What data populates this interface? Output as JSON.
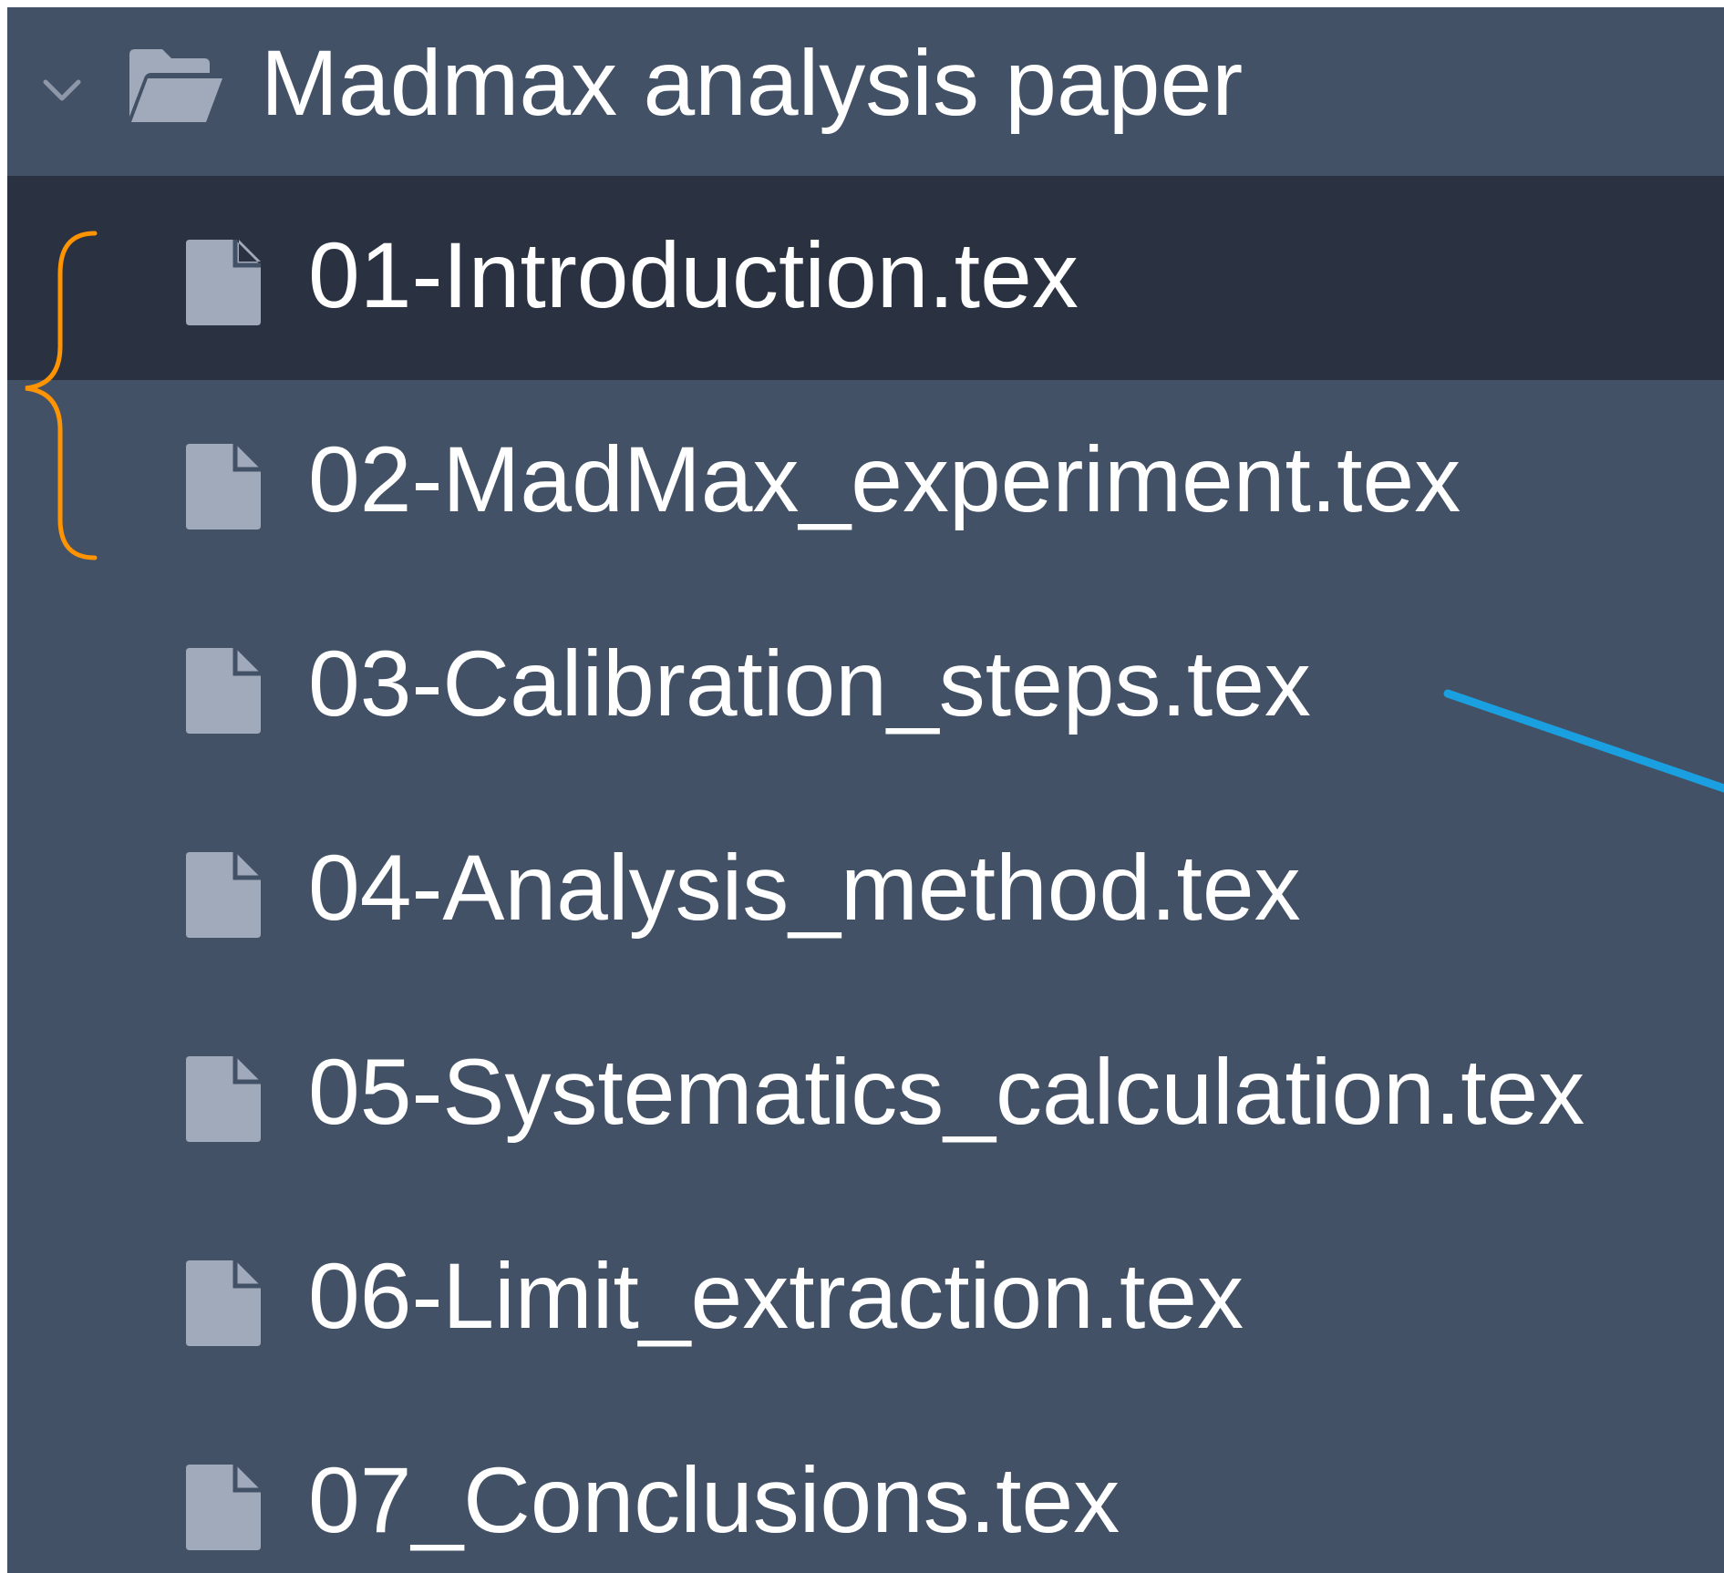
{
  "tree": {
    "folder": {
      "label": "Madmax analysis paper",
      "icon": "folder-open-icon",
      "expanded": true
    },
    "files": [
      {
        "label": "01-Introduction.tex",
        "icon": "file-icon",
        "selected": true
      },
      {
        "label": "02-MadMax_experiment.tex",
        "icon": "file-icon",
        "selected": false
      },
      {
        "label": "03-Calibration_steps.tex",
        "icon": "file-icon",
        "selected": false
      },
      {
        "label": "04-Analysis_method.tex",
        "icon": "file-icon",
        "selected": false
      },
      {
        "label": "05-Systematics_calculation.tex",
        "icon": "file-icon",
        "selected": false
      },
      {
        "label": "06-Limit_extraction.tex",
        "icon": "file-icon",
        "selected": false
      },
      {
        "label": "07_Conclusions.tex",
        "icon": "file-icon",
        "selected": false
      }
    ]
  },
  "colors": {
    "panel_bg": "#435166",
    "selected_bg": "#2a3242",
    "icon_gray": "#a0aabb",
    "brace_orange": "#ff9400",
    "arrow_blue": "#1aa0e0"
  }
}
